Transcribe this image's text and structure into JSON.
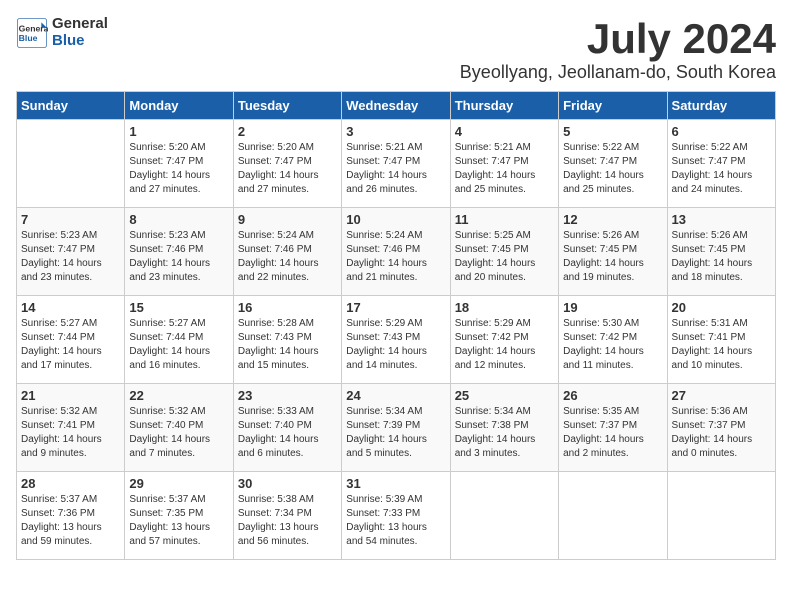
{
  "header": {
    "logo_general": "General",
    "logo_blue": "Blue",
    "month_title": "July 2024",
    "location": "Byeollyang, Jeollanam-do, South Korea"
  },
  "days_of_week": [
    "Sunday",
    "Monday",
    "Tuesday",
    "Wednesday",
    "Thursday",
    "Friday",
    "Saturday"
  ],
  "weeks": [
    {
      "days": [
        {
          "num": "",
          "empty": true
        },
        {
          "num": "1",
          "sunrise": "5:20 AM",
          "sunset": "7:47 PM",
          "daylight": "14 hours and 27 minutes."
        },
        {
          "num": "2",
          "sunrise": "5:20 AM",
          "sunset": "7:47 PM",
          "daylight": "14 hours and 27 minutes."
        },
        {
          "num": "3",
          "sunrise": "5:21 AM",
          "sunset": "7:47 PM",
          "daylight": "14 hours and 26 minutes."
        },
        {
          "num": "4",
          "sunrise": "5:21 AM",
          "sunset": "7:47 PM",
          "daylight": "14 hours and 25 minutes."
        },
        {
          "num": "5",
          "sunrise": "5:22 AM",
          "sunset": "7:47 PM",
          "daylight": "14 hours and 25 minutes."
        },
        {
          "num": "6",
          "sunrise": "5:22 AM",
          "sunset": "7:47 PM",
          "daylight": "14 hours and 24 minutes."
        }
      ]
    },
    {
      "days": [
        {
          "num": "7",
          "sunrise": "5:23 AM",
          "sunset": "7:47 PM",
          "daylight": "14 hours and 23 minutes."
        },
        {
          "num": "8",
          "sunrise": "5:23 AM",
          "sunset": "7:46 PM",
          "daylight": "14 hours and 23 minutes."
        },
        {
          "num": "9",
          "sunrise": "5:24 AM",
          "sunset": "7:46 PM",
          "daylight": "14 hours and 22 minutes."
        },
        {
          "num": "10",
          "sunrise": "5:24 AM",
          "sunset": "7:46 PM",
          "daylight": "14 hours and 21 minutes."
        },
        {
          "num": "11",
          "sunrise": "5:25 AM",
          "sunset": "7:45 PM",
          "daylight": "14 hours and 20 minutes."
        },
        {
          "num": "12",
          "sunrise": "5:26 AM",
          "sunset": "7:45 PM",
          "daylight": "14 hours and 19 minutes."
        },
        {
          "num": "13",
          "sunrise": "5:26 AM",
          "sunset": "7:45 PM",
          "daylight": "14 hours and 18 minutes."
        }
      ]
    },
    {
      "days": [
        {
          "num": "14",
          "sunrise": "5:27 AM",
          "sunset": "7:44 PM",
          "daylight": "14 hours and 17 minutes."
        },
        {
          "num": "15",
          "sunrise": "5:27 AM",
          "sunset": "7:44 PM",
          "daylight": "14 hours and 16 minutes."
        },
        {
          "num": "16",
          "sunrise": "5:28 AM",
          "sunset": "7:43 PM",
          "daylight": "14 hours and 15 minutes."
        },
        {
          "num": "17",
          "sunrise": "5:29 AM",
          "sunset": "7:43 PM",
          "daylight": "14 hours and 14 minutes."
        },
        {
          "num": "18",
          "sunrise": "5:29 AM",
          "sunset": "7:42 PM",
          "daylight": "14 hours and 12 minutes."
        },
        {
          "num": "19",
          "sunrise": "5:30 AM",
          "sunset": "7:42 PM",
          "daylight": "14 hours and 11 minutes."
        },
        {
          "num": "20",
          "sunrise": "5:31 AM",
          "sunset": "7:41 PM",
          "daylight": "14 hours and 10 minutes."
        }
      ]
    },
    {
      "days": [
        {
          "num": "21",
          "sunrise": "5:32 AM",
          "sunset": "7:41 PM",
          "daylight": "14 hours and 9 minutes."
        },
        {
          "num": "22",
          "sunrise": "5:32 AM",
          "sunset": "7:40 PM",
          "daylight": "14 hours and 7 minutes."
        },
        {
          "num": "23",
          "sunrise": "5:33 AM",
          "sunset": "7:40 PM",
          "daylight": "14 hours and 6 minutes."
        },
        {
          "num": "24",
          "sunrise": "5:34 AM",
          "sunset": "7:39 PM",
          "daylight": "14 hours and 5 minutes."
        },
        {
          "num": "25",
          "sunrise": "5:34 AM",
          "sunset": "7:38 PM",
          "daylight": "14 hours and 3 minutes."
        },
        {
          "num": "26",
          "sunrise": "5:35 AM",
          "sunset": "7:37 PM",
          "daylight": "14 hours and 2 minutes."
        },
        {
          "num": "27",
          "sunrise": "5:36 AM",
          "sunset": "7:37 PM",
          "daylight": "14 hours and 0 minutes."
        }
      ]
    },
    {
      "days": [
        {
          "num": "28",
          "sunrise": "5:37 AM",
          "sunset": "7:36 PM",
          "daylight": "13 hours and 59 minutes."
        },
        {
          "num": "29",
          "sunrise": "5:37 AM",
          "sunset": "7:35 PM",
          "daylight": "13 hours and 57 minutes."
        },
        {
          "num": "30",
          "sunrise": "5:38 AM",
          "sunset": "7:34 PM",
          "daylight": "13 hours and 56 minutes."
        },
        {
          "num": "31",
          "sunrise": "5:39 AM",
          "sunset": "7:33 PM",
          "daylight": "13 hours and 54 minutes."
        },
        {
          "num": "",
          "empty": true
        },
        {
          "num": "",
          "empty": true
        },
        {
          "num": "",
          "empty": true
        }
      ]
    }
  ]
}
